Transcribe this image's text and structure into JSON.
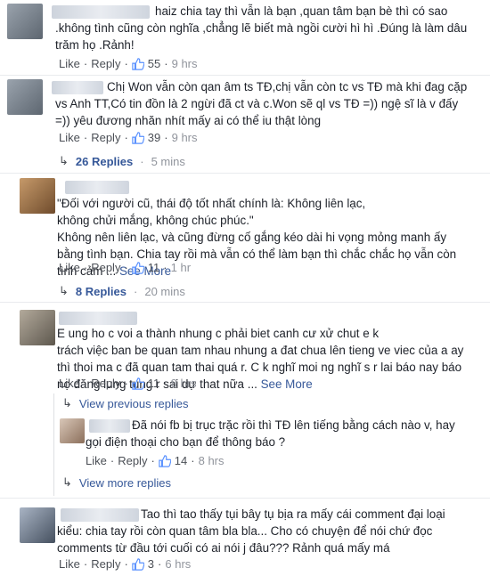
{
  "common": {
    "like": "Like",
    "reply": "Reply",
    "dot": "·"
  },
  "comments": [
    {
      "text": "haiz chia tay thì vẫn là bạn ,quan tâm bạn bè thì có sao\n.không tình cũng còn nghĩa ,chẳng lẽ biết mà ngồi cười hì hì .Đúng là làm dâu\ntrăm họ .Rảnh!",
      "likes": "55",
      "time": "9 hrs"
    },
    {
      "text": "Chị Won vẫn còn qan âm ts TĐ,chị vẫn còn tc vs TĐ mà khi đag cặp\nvs Anh TT,Có tin đồn là 2 ngừi đã ct và c.Won sẽ ql vs TĐ =)) ngệ sĩ là v đấy\n=)) yêu đương nhăn nhít mấy ai có thể iu thật lòng",
      "likes": "39",
      "time": "9 hrs",
      "replies_label": "26 Replies",
      "replies_time": "5 mins"
    },
    {
      "text": "\"Đối với người cũ, thái độ tốt nhất chính là: Không liên lạc,\nkhông chửi mắng, không chúc phúc.\"\nKhông nên liên lạc, và cũng đừng cố gắng kéo dài hi vọng mỏng manh ấy\nbằng tình bạn. Chia tay rồi mà vẫn có thể làm bạn thì chắc chắc họ vẫn còn\ntình cảm ...",
      "see_more": "See More",
      "likes": "11",
      "time": "1 hr",
      "replies_label": "8 Replies",
      "replies_time": "20 mins"
    },
    {
      "text": "E ung ho c voi a thành nhung c phải biet canh cư xử chut e k\ntrách việc ban be quan tam nhau nhung a đat chua lên tieng ve viec của a ay\nthì thoi ma c đã quan tam thai quá r. C k nghĩ moi ng nghĩ s r lai báo nay báo\nnọ đăng lung tung r sai dự that nữa ...",
      "see_more": "See More",
      "likes": "11",
      "time": "8 hrs",
      "view_previous": "View previous replies",
      "view_more": "View more replies",
      "reply": {
        "text": "Đã nói fb bị trục trặc rồi thì TĐ lên tiếng bằng cách nào v, hay\ngọi điện thoại cho bạn để thông báo ?",
        "likes": "14",
        "time": "8 hrs"
      }
    },
    {
      "text": "Tao thì tao thấy tụi bây tụ bịa ra mấy cái comment đại loại\nkiểu: chia tay rồi còn quan tâm bla bla... Cho có chuyện để nói chứ đọc\ncomments từ đầu tới cuối có ai nói j đâu??? Rảnh quá mấy má",
      "likes": "3",
      "time": "6 hrs"
    }
  ],
  "colors": {
    "link": "#365899",
    "text": "#1d2129",
    "meta": "#90949c",
    "like_icon": "#5890ff"
  },
  "icons": {
    "like": "thumbs-up-icon",
    "reply_arrow": "reply-arrow-icon"
  }
}
